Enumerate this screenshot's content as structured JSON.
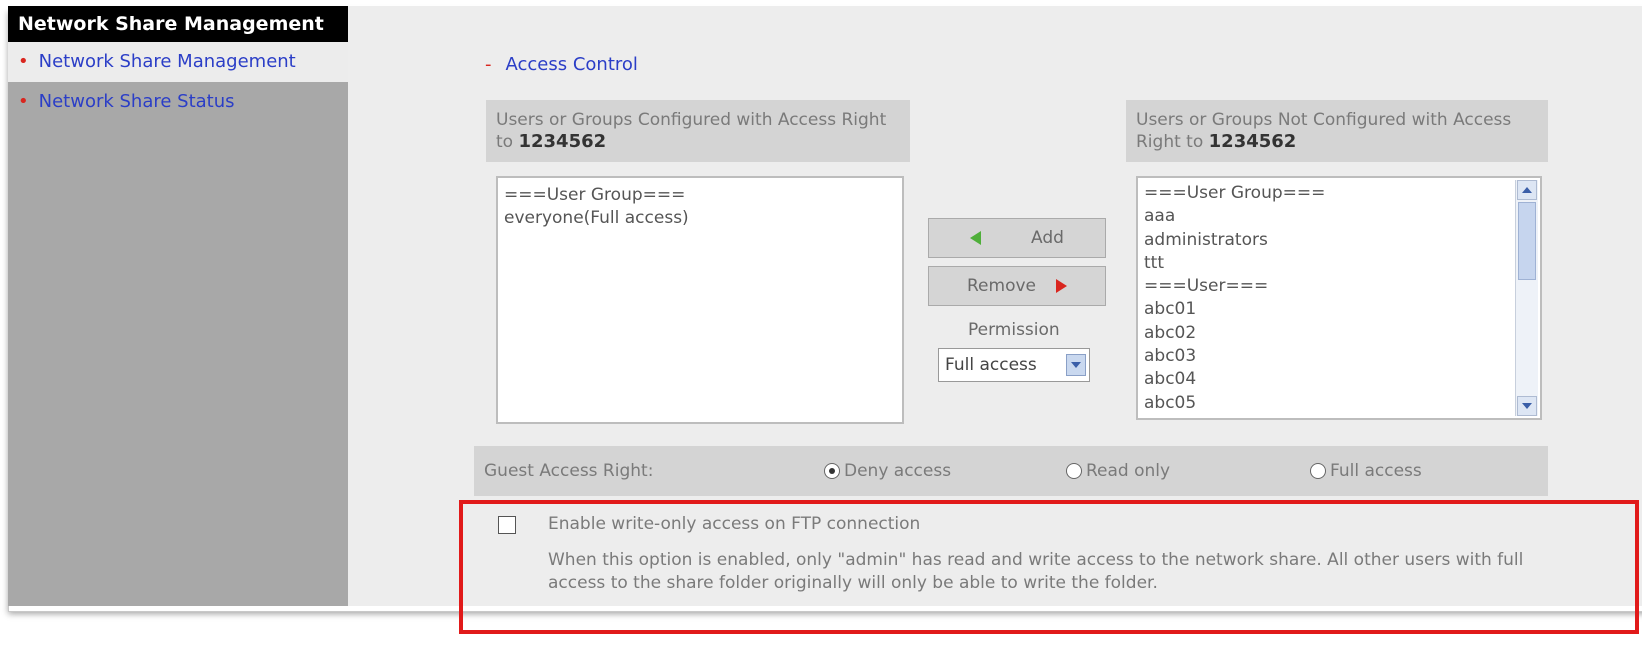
{
  "sidebar": {
    "title": "Network Share Management",
    "items": [
      {
        "label": "Network Share Management",
        "active": true
      },
      {
        "label": "Network Share Status",
        "active": false
      }
    ]
  },
  "main": {
    "section_title": "Access Control",
    "configured": {
      "header_prefix": "Users or Groups Configured with Access Right to",
      "share_name": "1234562",
      "items": [
        "===User Group===",
        "everyone(Full access)"
      ]
    },
    "not_configured": {
      "header_prefix": "Users or Groups Not Configured with Access Right to",
      "share_name": "1234562",
      "items": [
        "===User Group===",
        "aaa",
        "administrators",
        "ttt",
        "===User===",
        "abc01",
        "abc02",
        "abc03",
        "abc04",
        "abc05"
      ]
    },
    "add_label": "Add",
    "remove_label": "Remove",
    "permission_label": "Permission",
    "permission_value": "Full access",
    "guest": {
      "label": "Guest Access Right:",
      "options": [
        "Deny access",
        "Read only",
        "Full access"
      ],
      "selected": "Deny access"
    },
    "ftp_option": {
      "label": "Enable write-only access on FTP connection",
      "checked": false,
      "description": "When this option is enabled, only \"admin\" has read and write access to the network share. All other users with full access to the share folder originally will only be able to write the folder."
    }
  },
  "colors": {
    "link": "#2b3ec7",
    "bullet": "#d9261f",
    "highlight": "#e11a1a",
    "add_arrow": "#4faf3a",
    "remove_arrow": "#d9261f"
  },
  "icons": [
    "arrow-left-icon",
    "arrow-right-icon",
    "chevron-down-icon",
    "scroll-up-icon",
    "scroll-down-icon"
  ]
}
